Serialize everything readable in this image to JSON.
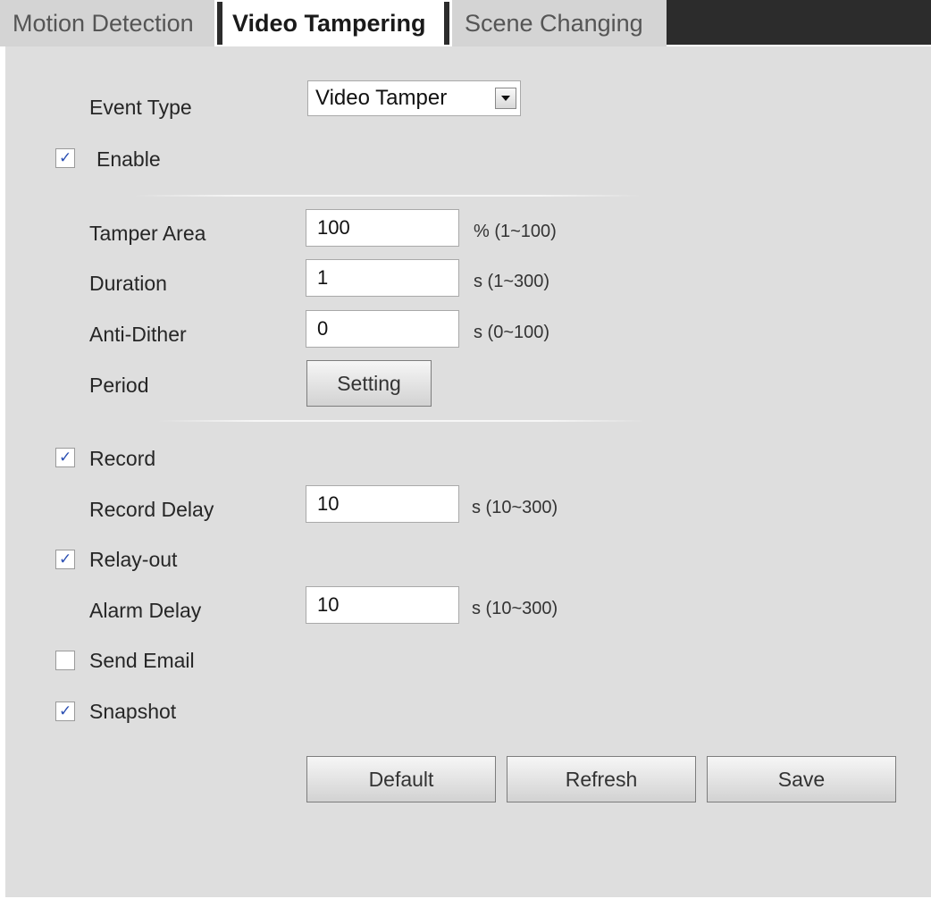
{
  "tabs": [
    {
      "label": "Motion Detection",
      "active": false
    },
    {
      "label": "Video Tampering",
      "active": true
    },
    {
      "label": "Scene Changing",
      "active": false
    }
  ],
  "form": {
    "event_type": {
      "label": "Event Type",
      "value": "Video Tamper"
    },
    "enable": {
      "label": "Enable",
      "checked": true
    },
    "tamper_area": {
      "label": "Tamper Area",
      "value": "100",
      "unit": "% (1~100)"
    },
    "duration": {
      "label": "Duration",
      "value": "1",
      "unit": "s (1~300)"
    },
    "anti_dither": {
      "label": "Anti-Dither",
      "value": "0",
      "unit": "s (0~100)"
    },
    "period": {
      "label": "Period",
      "button": "Setting"
    },
    "record": {
      "label": "Record",
      "checked": true
    },
    "record_delay": {
      "label": "Record Delay",
      "value": "10",
      "unit": "s (10~300)"
    },
    "relay_out": {
      "label": "Relay-out",
      "checked": true
    },
    "alarm_delay": {
      "label": "Alarm Delay",
      "value": "10",
      "unit": "s (10~300)"
    },
    "send_email": {
      "label": "Send Email",
      "checked": false
    },
    "snapshot": {
      "label": "Snapshot",
      "checked": true
    }
  },
  "actions": {
    "default": "Default",
    "refresh": "Refresh",
    "save": "Save"
  },
  "icons": {
    "checkbox_tick": "✓",
    "dropdown": "chevron-down-icon"
  },
  "colors": {
    "panel_bg": "#dedede",
    "tab_bar_dark": "#2c2c2c",
    "tick": "#2b4fb3"
  }
}
